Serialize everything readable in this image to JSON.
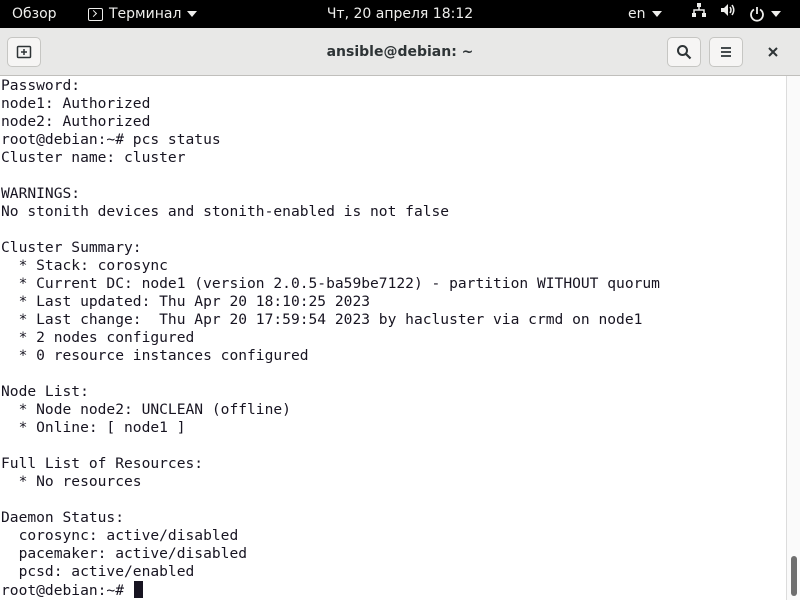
{
  "topbar": {
    "activities": "Обзор",
    "app_name": "Терминал",
    "app_icon": "terminal-icon",
    "clock": "Чт, 20 апреля  18:12",
    "language": "en",
    "icons": [
      "network-icon",
      "volume-icon",
      "power-icon"
    ]
  },
  "window": {
    "title": "ansible@debian: ~",
    "new_tab_icon": "new-tab-icon",
    "search_icon": "search-icon",
    "menu_icon": "hamburger-menu-icon",
    "close_icon": "close-icon"
  },
  "terminal": {
    "lines": [
      "Password:",
      "node1: Authorized",
      "node2: Authorized",
      "root@debian:~# pcs status",
      "Cluster name: cluster",
      "",
      "WARNINGS:",
      "No stonith devices and stonith-enabled is not false",
      "",
      "Cluster Summary:",
      "  * Stack: corosync",
      "  * Current DC: node1 (version 2.0.5-ba59be7122) - partition WITHOUT quorum",
      "  * Last updated: Thu Apr 20 18:10:25 2023",
      "  * Last change:  Thu Apr 20 17:59:54 2023 by hacluster via crmd on node1",
      "  * 2 nodes configured",
      "  * 0 resource instances configured",
      "",
      "Node List:",
      "  * Node node2: UNCLEAN (offline)",
      "  * Online: [ node1 ]",
      "",
      "Full List of Resources:",
      "  * No resources",
      "",
      "Daemon Status:",
      "  corosync: active/disabled",
      "  pacemaker: active/disabled",
      "  pcsd: active/enabled"
    ],
    "prompt": "root@debian:~# "
  },
  "colors": {
    "topbar_bg": "#000000",
    "headerbar_bg": "#e8e8e7",
    "terminal_bg": "#ffffff",
    "terminal_fg": "#171421"
  }
}
